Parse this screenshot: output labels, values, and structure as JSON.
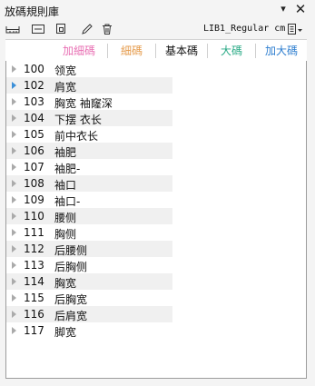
{
  "window": {
    "title": "放碼規則庫",
    "pin_glyph": "▾",
    "close_glyph": "✕"
  },
  "toolbar": {
    "icons": [
      "ruler-icon",
      "rectangle-icon",
      "copy-icon",
      "pencil-icon",
      "trash-icon"
    ],
    "unit_label": "LIB1_Regular cm",
    "unit_menu_icon": "document-menu-icon"
  },
  "tabs": [
    {
      "label": "加細碼",
      "color": "#e86fb3"
    },
    {
      "label": "細碼",
      "color": "#e59a4a"
    },
    {
      "label": "基本碼",
      "color": "#111111"
    },
    {
      "label": "大碼",
      "color": "#2aaa86"
    },
    {
      "label": "加大碼",
      "color": "#2f7fd0"
    }
  ],
  "rows": [
    {
      "num": "100",
      "name": "领宽"
    },
    {
      "num": "102",
      "name": "肩宽"
    },
    {
      "num": "103",
      "name": "胸宽 袖窿深"
    },
    {
      "num": "104",
      "name": "下摆 衣长"
    },
    {
      "num": "105",
      "name": "前中衣长"
    },
    {
      "num": "106",
      "name": "袖肥"
    },
    {
      "num": "107",
      "name": "袖肥-"
    },
    {
      "num": "108",
      "name": "袖口"
    },
    {
      "num": "109",
      "name": "袖口-"
    },
    {
      "num": "110",
      "name": "腰侧"
    },
    {
      "num": "111",
      "name": "胸侧"
    },
    {
      "num": "112",
      "name": "后腰侧"
    },
    {
      "num": "113",
      "name": "后胸侧"
    },
    {
      "num": "114",
      "name": "胸宽"
    },
    {
      "num": "115",
      "name": "后胸宽"
    },
    {
      "num": "116",
      "name": "后肩宽"
    },
    {
      "num": "117",
      "name": "脚宽"
    }
  ],
  "active_row": "102",
  "colors": {
    "active_arrow": "#3b8fd8",
    "inactive_arrow": "#aaaaaa",
    "alt_row": "#f0f0f0"
  }
}
